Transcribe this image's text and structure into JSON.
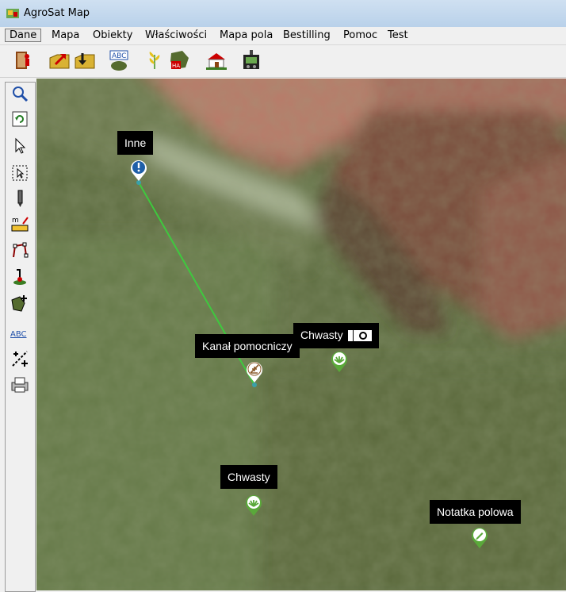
{
  "window": {
    "title": "AgroSat Map"
  },
  "menu": [
    "Dane",
    "Mapa",
    "Obiekty",
    "Właściwości",
    "Mapa pola",
    "Bestilling",
    "Pomoc",
    "Test"
  ],
  "toolbar_icons": [
    "exit-icon",
    "import-icon",
    "export-icon",
    "labels-icon",
    "crop-icon",
    "area-ha-icon",
    "farm-icon",
    "gps-icon"
  ],
  "left_tools": [
    "zoom-icon",
    "refresh-icon",
    "select-icon",
    "rect-select-icon",
    "pencil-icon",
    "measure-icon",
    "polygon-edit-icon",
    "gps-track-icon",
    "add-field-icon",
    "text-icon",
    "split-icon",
    "print-icon"
  ],
  "markers": {
    "inne": {
      "label": "Inne",
      "icon": "exclamation-icon"
    },
    "kanal": {
      "label": "Kanał pomocniczy",
      "icon": "channel-icon"
    },
    "chwasty1": {
      "label": "Chwasty",
      "icon": "weed-icon",
      "attachment": "camera-icon"
    },
    "chwasty2": {
      "label": "Chwasty",
      "icon": "weed-icon"
    },
    "notatka": {
      "label": "Notatka polowa",
      "icon": "pen-icon"
    }
  },
  "colors": {
    "line": "#3ec93e",
    "pin_green": "#5aa83a",
    "pin_blue": "#1f5fa8",
    "label_bg": "#000000"
  }
}
